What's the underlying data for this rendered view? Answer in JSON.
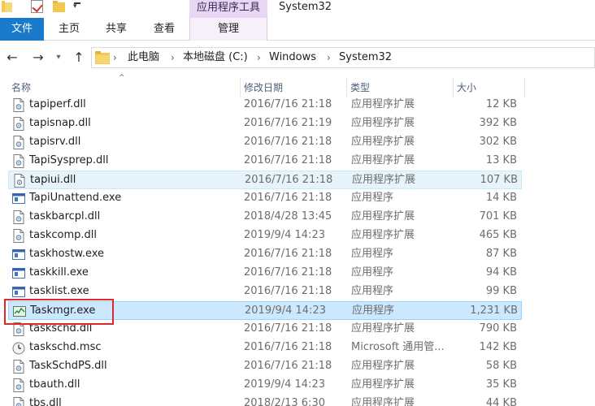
{
  "titlebar": {
    "context_tab_title": "应用程序工具",
    "window_title": "System32"
  },
  "ribbon": {
    "tabs": [
      "文件",
      "主页",
      "共享",
      "查看",
      "管理"
    ]
  },
  "address": {
    "crumbs": [
      "此电脑",
      "本地磁盘 (C:)",
      "Windows",
      "System32"
    ]
  },
  "columns": {
    "name": "名称",
    "date": "修改日期",
    "type": "类型",
    "size": "大小"
  },
  "files": [
    {
      "name": "tapiperf.dll",
      "date": "2016/7/16 21:18",
      "type": "应用程序扩展",
      "size": "12 KB",
      "icon": "dll-icon"
    },
    {
      "name": "tapisnap.dll",
      "date": "2016/7/16 21:19",
      "type": "应用程序扩展",
      "size": "392 KB",
      "icon": "dll-icon"
    },
    {
      "name": "tapisrv.dll",
      "date": "2016/7/16 21:18",
      "type": "应用程序扩展",
      "size": "302 KB",
      "icon": "dll-icon"
    },
    {
      "name": "TapiSysprep.dll",
      "date": "2016/7/16 21:18",
      "type": "应用程序扩展",
      "size": "13 KB",
      "icon": "dll-icon"
    },
    {
      "name": "tapiui.dll",
      "date": "2016/7/16 21:18",
      "type": "应用程序扩展",
      "size": "107 KB",
      "icon": "dll-icon"
    },
    {
      "name": "TapiUnattend.exe",
      "date": "2016/7/16 21:18",
      "type": "应用程序",
      "size": "14 KB",
      "icon": "exe-icon"
    },
    {
      "name": "taskbarcpl.dll",
      "date": "2018/4/28 13:45",
      "type": "应用程序扩展",
      "size": "701 KB",
      "icon": "dll-icon"
    },
    {
      "name": "taskcomp.dll",
      "date": "2019/9/4 14:23",
      "type": "应用程序扩展",
      "size": "465 KB",
      "icon": "dll-icon"
    },
    {
      "name": "taskhostw.exe",
      "date": "2016/7/16 21:18",
      "type": "应用程序",
      "size": "87 KB",
      "icon": "exe-icon"
    },
    {
      "name": "taskkill.exe",
      "date": "2016/7/16 21:18",
      "type": "应用程序",
      "size": "94 KB",
      "icon": "exe-icon"
    },
    {
      "name": "tasklist.exe",
      "date": "2016/7/16 21:18",
      "type": "应用程序",
      "size": "99 KB",
      "icon": "exe-icon"
    },
    {
      "name": "Taskmgr.exe",
      "date": "2019/9/4 14:23",
      "type": "应用程序",
      "size": "1,231 KB",
      "icon": "task-manager-icon"
    },
    {
      "name": "taskschd.dll",
      "date": "2016/7/16 21:18",
      "type": "应用程序扩展",
      "size": "790 KB",
      "icon": "dll-icon"
    },
    {
      "name": "taskschd.msc",
      "date": "2016/7/16 21:18",
      "type": "Microsoft 通用管...",
      "size": "142 KB",
      "icon": "clock-icon"
    },
    {
      "name": "TaskSchdPS.dll",
      "date": "2016/7/16 21:18",
      "type": "应用程序扩展",
      "size": "58 KB",
      "icon": "dll-icon"
    },
    {
      "name": "tbauth.dll",
      "date": "2019/9/4 14:23",
      "type": "应用程序扩展",
      "size": "35 KB",
      "icon": "dll-icon"
    },
    {
      "name": "tbs.dll",
      "date": "2018/2/13 6:30",
      "type": "应用程序扩展",
      "size": "44 KB",
      "icon": "dll-icon"
    }
  ],
  "hover_row": 4,
  "selected_row": 11,
  "colors": {
    "file_tab": "#1979ca",
    "context_tab": "#e8d7f4",
    "selected_row": "#cce8ff",
    "hover_row": "#e5f3fb",
    "highlight_box": "#e02a2a",
    "folder": "#f2c94c"
  }
}
